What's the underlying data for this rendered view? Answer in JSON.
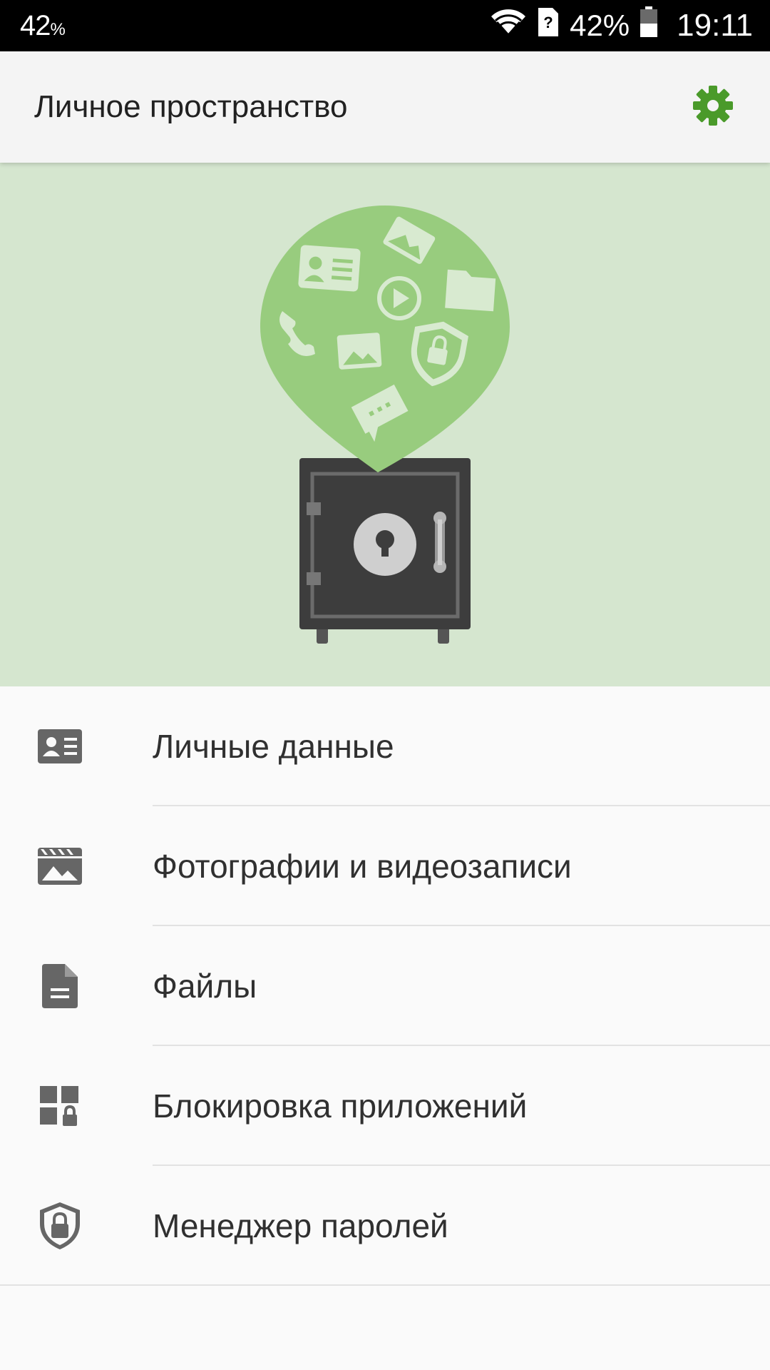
{
  "status_bar": {
    "left_indicator": "42",
    "left_indicator_unit": "%",
    "battery_percent": "42%",
    "time": "19:11",
    "icons": [
      "wifi-icon",
      "sim-unknown-icon",
      "battery-icon"
    ]
  },
  "app_bar": {
    "title": "Личное пространство",
    "settings_icon": "gear-icon",
    "accent_color": "#4a9a2a"
  },
  "hero": {
    "illustration": "safe-with-speech-bubble",
    "background_color": "#d5e6cf",
    "bubble_color": "#98cc7e",
    "bubble_icons": [
      "contact-card-icon",
      "photo-icon",
      "play-icon",
      "folder-icon",
      "phone-icon",
      "image-icon",
      "shield-lock-icon",
      "message-icon"
    ]
  },
  "menu": {
    "items": [
      {
        "label": "Личные данные",
        "icon": "contact-card-icon"
      },
      {
        "label": "Фотографии и видеозаписи",
        "icon": "photo-video-icon"
      },
      {
        "label": "Файлы",
        "icon": "document-icon"
      },
      {
        "label": "Блокировка приложений",
        "icon": "app-lock-icon"
      },
      {
        "label": "Менеджер паролей",
        "icon": "shield-lock-icon"
      }
    ]
  }
}
